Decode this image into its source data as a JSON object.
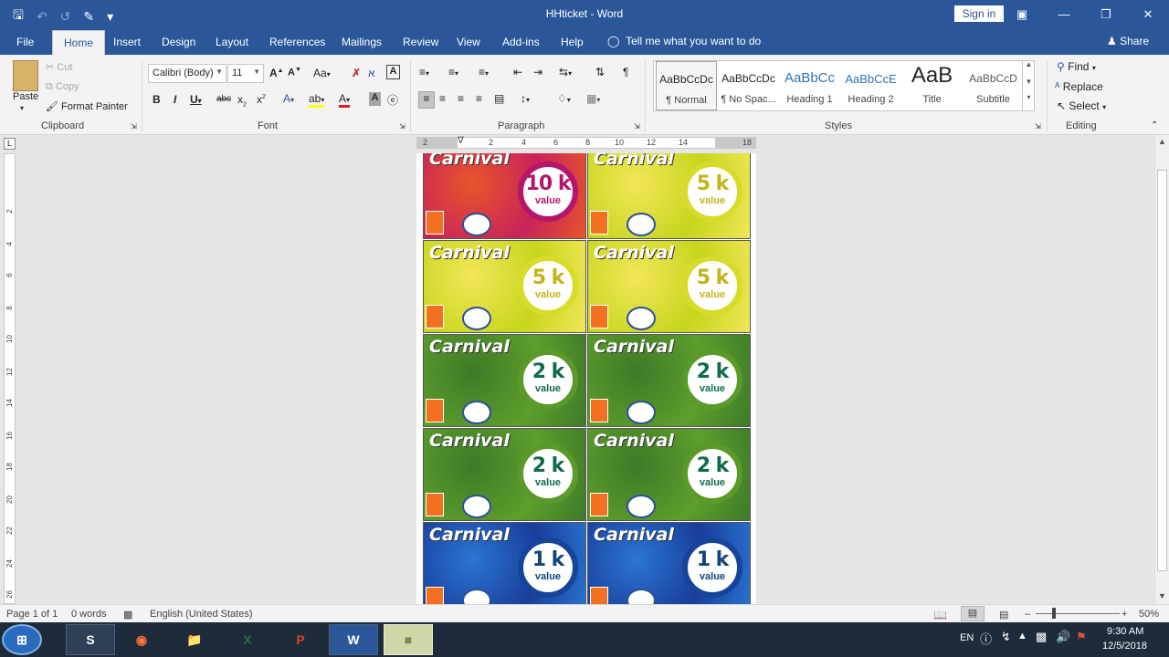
{
  "titlebar": {
    "document_title": "HHticket  -  Word",
    "sign_in": "Sign in"
  },
  "tabs": [
    "File",
    "Home",
    "Insert",
    "Design",
    "Layout",
    "References",
    "Mailings",
    "Review",
    "View",
    "Add-ins",
    "Help"
  ],
  "tell_me": "Tell me what you want to do",
  "share": "Share",
  "clipboard": {
    "paste": "Paste",
    "cut": "Cut",
    "copy": "Copy",
    "format_painter": "Format Painter",
    "label": "Clipboard"
  },
  "font": {
    "family": "Calibri (Body)",
    "size": "11",
    "case_btn": "Aa",
    "label": "Font"
  },
  "paragraph": {
    "label": "Paragraph"
  },
  "styles": {
    "label": "Styles",
    "items": [
      {
        "preview": "AaBbCcDc",
        "name": "¶ Normal"
      },
      {
        "preview": "AaBbCcDc",
        "name": "¶ No Spac..."
      },
      {
        "preview": "AaBbCc",
        "name": "Heading 1"
      },
      {
        "preview": "AaBbCcE",
        "name": "Heading 2"
      },
      {
        "preview": "AaB",
        "name": "Title"
      },
      {
        "preview": "AaBbCcD",
        "name": "Subtitle"
      }
    ]
  },
  "editing": {
    "find": "Find",
    "replace": "Replace",
    "select": "Select",
    "label": "Editing"
  },
  "ruler": {
    "h_ticks": [
      "2",
      "2",
      "4",
      "6",
      "8",
      "10",
      "12",
      "14",
      "18"
    ],
    "v_ticks": [
      "2",
      "4",
      "6",
      "8",
      "10",
      "12",
      "14",
      "16",
      "18",
      "20",
      "22",
      "24",
      "26"
    ]
  },
  "tickets": [
    {
      "title": "Carnival",
      "value": "10 k",
      "label": "value",
      "theme": "pink"
    },
    {
      "title": "Carnival",
      "value": "5 k",
      "label": "value",
      "theme": "yellow"
    },
    {
      "title": "Carnival",
      "value": "5 k",
      "label": "value",
      "theme": "yellow"
    },
    {
      "title": "Carnival",
      "value": "5 k",
      "label": "value",
      "theme": "yellow"
    },
    {
      "title": "Carnival",
      "value": "2 k",
      "label": "value",
      "theme": "green"
    },
    {
      "title": "Carnival",
      "value": "2 k",
      "label": "value",
      "theme": "green"
    },
    {
      "title": "Carnival",
      "value": "2 k",
      "label": "value",
      "theme": "green"
    },
    {
      "title": "Carnival",
      "value": "2 k",
      "label": "value",
      "theme": "green"
    },
    {
      "title": "Carnival",
      "value": "1 k",
      "label": "value",
      "theme": "blue"
    },
    {
      "title": "Carnival",
      "value": "1 k",
      "label": "value",
      "theme": "blue"
    }
  ],
  "themes": {
    "pink": {
      "bg": "#c8235a",
      "bg2": "#e8552a",
      "ring": "#b5166a",
      "text": "#b5166a"
    },
    "yellow": {
      "bg": "#c6d61c",
      "bg2": "#f2e65a",
      "ring": "#d7dc2a",
      "text": "#c2b41a"
    },
    "green": {
      "bg": "#5e9e2a",
      "bg2": "#3d7a2a",
      "ring": "#5b9a2a",
      "text": "#0f6b4a"
    },
    "blue": {
      "bg": "#1a3d9a",
      "bg2": "#2a76d2",
      "ring": "#16449a",
      "text": "#13447a"
    }
  },
  "status": {
    "page": "Page 1 of 1",
    "words": "0 words",
    "language": "English (United States)",
    "zoom": "50%"
  },
  "tray": {
    "lang": "EN",
    "time": "9:30 AM",
    "date": "12/5/2018"
  }
}
